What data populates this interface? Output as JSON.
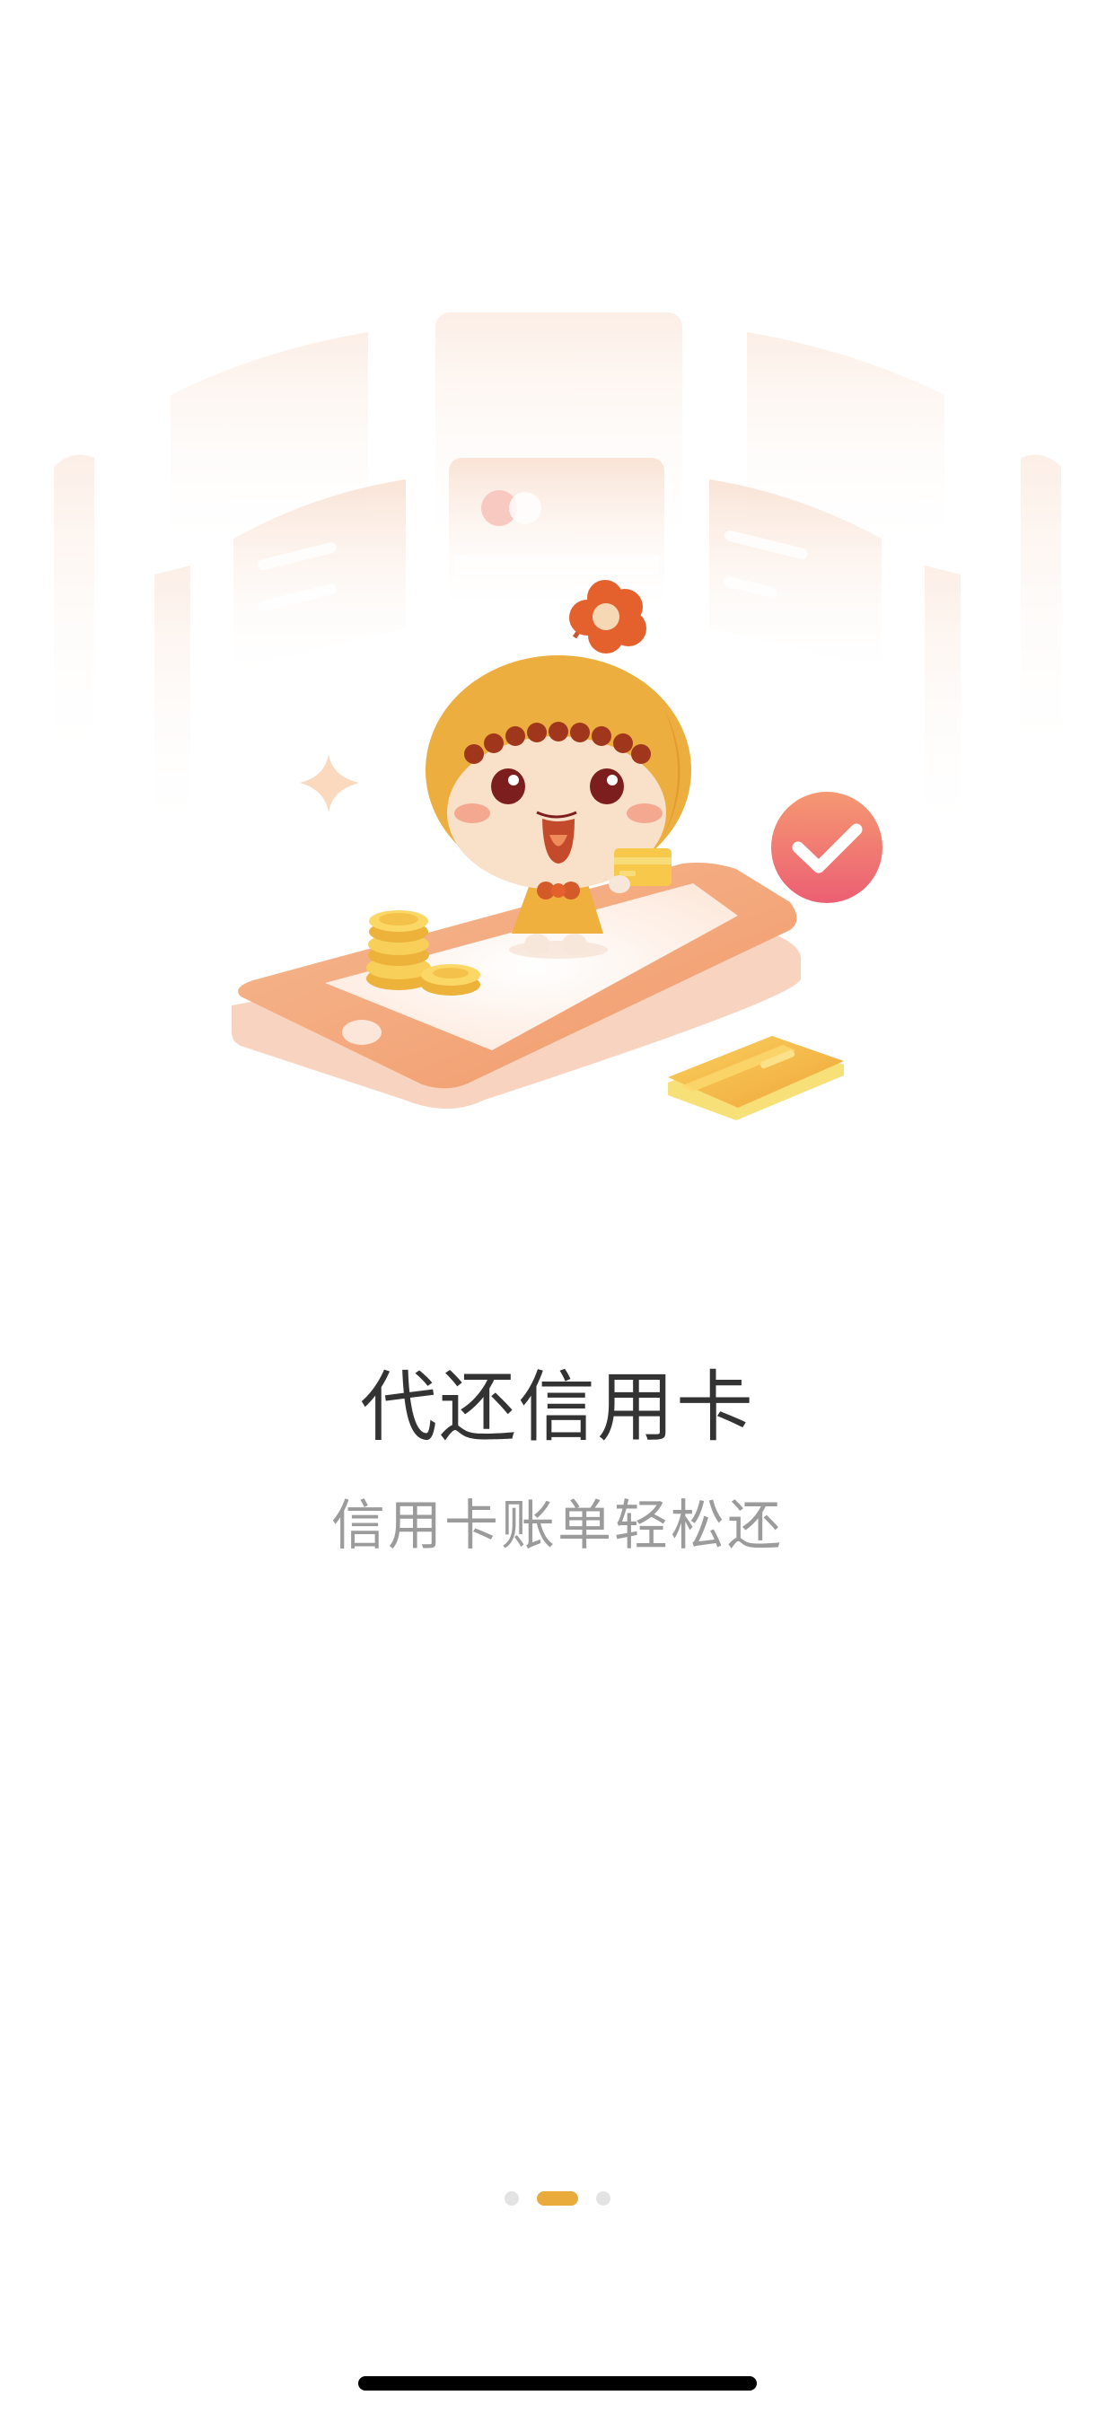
{
  "onboarding": {
    "title": "代还信用卡",
    "subtitle": "信用卡账单轻松还"
  },
  "pager": {
    "page_count": 3,
    "current_page": 2
  },
  "illustration": {
    "icons": [
      "credit-card-icon",
      "coins-icon",
      "phone-icon",
      "checkmark-icon",
      "sparkle-icon",
      "mascot-icon"
    ]
  },
  "colors": {
    "accent": "#e9ab3c",
    "phone": "#f3a77b",
    "check": "#ee6c6e",
    "title": "#333333",
    "subtitle": "#9b9b9b"
  }
}
